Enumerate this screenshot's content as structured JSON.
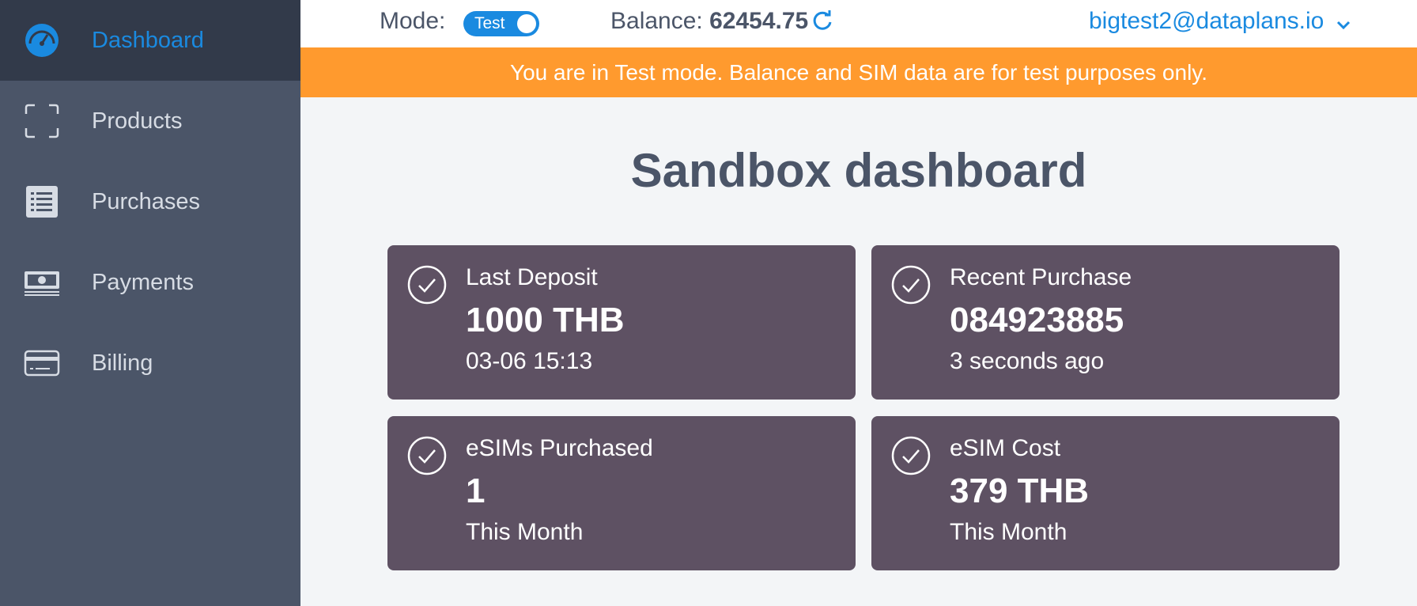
{
  "sidebar": {
    "items": [
      {
        "label": "Dashboard",
        "icon": "speedometer-icon",
        "active": true
      },
      {
        "label": "Products",
        "icon": "scan-frame-icon"
      },
      {
        "label": "Purchases",
        "icon": "list-icon"
      },
      {
        "label": "Payments",
        "icon": "banknote-icon"
      },
      {
        "label": "Billing",
        "icon": "credit-card-icon"
      }
    ]
  },
  "topbar": {
    "mode_label": "Mode:",
    "mode_value": "Test",
    "balance_label": "Balance:",
    "balance_value": "62454.75",
    "account": "bigtest2@dataplans.io"
  },
  "banner": {
    "text": "You are in Test mode. Balance and SIM data are for test purposes only."
  },
  "main": {
    "title": "Sandbox dashboard",
    "cards": [
      {
        "label": "Last Deposit",
        "value": "1000 THB",
        "sub": "03-06 15:13"
      },
      {
        "label": "Recent Purchase",
        "value": "084923885",
        "sub": "3 seconds ago"
      },
      {
        "label": "eSIMs Purchased",
        "value": "1",
        "sub": "This Month"
      },
      {
        "label": "eSIM Cost",
        "value": "379 THB",
        "sub": "This Month"
      }
    ]
  },
  "colors": {
    "sidebar_bg": "#4b5568",
    "sidebar_active_bg": "#323a4a",
    "accent_blue": "#1a8ae0",
    "banner_orange": "#ff9a2e",
    "card_bg": "#5e5163",
    "page_bg": "#f3f5f7"
  }
}
